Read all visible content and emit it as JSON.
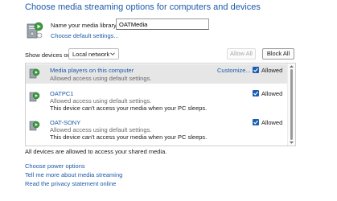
{
  "heading": "Choose media streaming options for computers and devices",
  "library": {
    "label": "Name your media library:",
    "value": "OATMedia",
    "choose_defaults_link": "Choose default settings..."
  },
  "show_devices": {
    "label": "Show devices on:",
    "selected": "Local network"
  },
  "buttons": {
    "allow_all": "Allow All",
    "block_all": "Block All"
  },
  "devices": [
    {
      "name": "Media players on this computer",
      "line1": "Allowed access using default settings.",
      "line2": "",
      "customize": "Customize...",
      "status": "Allowed",
      "checked": true,
      "selected": true
    },
    {
      "name": "OATPC1",
      "line1": "Allowed access using default settings.",
      "line2": "This device can't access your media when your PC sleeps.",
      "customize": "",
      "status": "Allowed",
      "checked": true,
      "selected": false
    },
    {
      "name": "OAT-SONY",
      "line1": "Allowed access using default settings.",
      "line2": "This device can't access your media when your PC sleeps.",
      "customize": "",
      "status": "Allowed",
      "checked": true,
      "selected": false
    }
  ],
  "status_text": "All devices are allowed to access your shared media.",
  "links": {
    "power": "Choose power options",
    "more": "Tell me more about media streaming",
    "privacy": "Read the privacy statement online"
  },
  "colors": {
    "link": "#1e5aa8",
    "checkbox": "#1a5fb4",
    "selected_row": "#e6e6e6"
  },
  "icons": {
    "library": "media-library-pc-icon",
    "device": "media-device-play-icon",
    "dropdown": "chevron-down-icon"
  }
}
